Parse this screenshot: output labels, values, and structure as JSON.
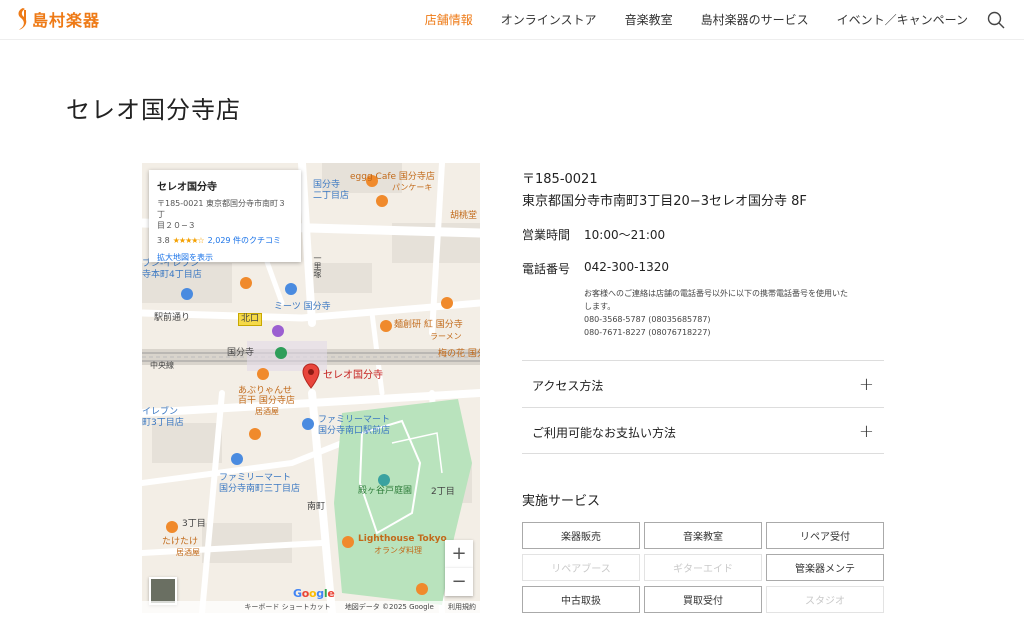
{
  "header": {
    "logo_text": "島村楽器",
    "nav": [
      "店舗情報",
      "オンラインストア",
      "音楽教室",
      "島村楽器のサービス",
      "イベント／キャンペーン"
    ],
    "active_index": 0,
    "accent_color": "#ee7a16"
  },
  "store": {
    "name": "セレオ国分寺店",
    "postal": "〒185-0021",
    "address": "東京都国分寺市南町3丁目20−3セレオ国分寺 8F",
    "hours_label": "営業時間",
    "hours": "10:00〜21:00",
    "phone_label": "電話番号",
    "phone": "042-300-1320",
    "notice_line1": "お客様へのご連絡は店舗の電話番号以外に以下の携帯電話番号を使用いた",
    "notice_line2": "します。",
    "mobile1": "080-3568-5787 (08035685787)",
    "mobile2": "080-7671-8227 (08076718227)"
  },
  "map": {
    "card_title": "セレオ国分寺",
    "card_address_1": "〒185-0021 東京都国分寺市南町３丁",
    "card_address_2": "目２０−３",
    "rating": "3.8",
    "stars": "★★★★☆",
    "reviews": "2,029 件のクチコミ",
    "enlarge_link": "拡大地図を表示",
    "marker_label": "セレオ国分寺",
    "labels": {
      "eggg": "eggg Cafe 国分寺店",
      "eggg_sub": "パンケーキ",
      "kokubunji_2": "国分寺",
      "nichome": "二丁目店",
      "kurumi": "胡桃堂",
      "eleven_a": "ブン-イレブン",
      "eleven_b": "寺本町4丁目店",
      "mitsu": "ミーツ 国分寺",
      "ekimae": "駅前通り",
      "kitaguchi": "北口",
      "menso": "麺創研 紅 国分寺",
      "ramen": "ラーメン",
      "station": "国分寺",
      "chuo": "中央線",
      "umenohana": "梅の花 国分",
      "abura1": "あぶりゃんせ",
      "abura2": "百干 国分寺店",
      "izakaya1": "居酒屋",
      "fm1a": "ファミリーマート",
      "fm1b": "国分寺南口駅前店",
      "eleven2a": "イレブン",
      "eleven2b": "町3丁目店",
      "fm2a": "ファミリーマート",
      "fm2b": "国分寺南町三丁目店",
      "tonogaya": "殿ヶ谷戸庭園",
      "minamicho": "南町",
      "nichome2": "2丁目",
      "sanchome": "3丁目",
      "taketake": "たけたけ",
      "izakaya2": "居酒屋",
      "lighthouse": "Lighthouse Tokyo",
      "dutch": "オランダ料理",
      "road": "一里塚"
    },
    "zoom_in": "+",
    "zoom_out": "−",
    "google": "Google",
    "attr_keyboard": "キーボード ショートカット",
    "attr_data": "地図データ ©2025 Google",
    "attr_terms": "利用規約"
  },
  "accordion": [
    "アクセス方法",
    "ご利用可能なお支払い方法"
  ],
  "services_title": "実施サービス",
  "services": [
    {
      "label": "楽器販売",
      "enabled": true
    },
    {
      "label": "音楽教室",
      "enabled": true
    },
    {
      "label": "リペア受付",
      "enabled": true
    },
    {
      "label": "リペアブース",
      "enabled": false
    },
    {
      "label": "ギターエイド",
      "enabled": false
    },
    {
      "label": "管楽器メンテ",
      "enabled": true
    },
    {
      "label": "中古取扱",
      "enabled": true
    },
    {
      "label": "買取受付",
      "enabled": true
    },
    {
      "label": "スタジオ",
      "enabled": false
    }
  ]
}
